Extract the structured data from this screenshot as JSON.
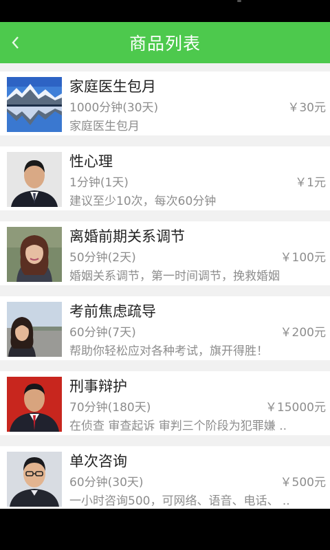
{
  "header": {
    "title": "商品列表",
    "back_icon": "chevron-left-icon"
  },
  "colors": {
    "accent": "#4dc94d",
    "title_text": "#222222",
    "secondary_text": "#8d8d8d"
  },
  "products": [
    {
      "title": "家庭医生包月",
      "duration": "1000分钟(30天)",
      "price": "￥30元",
      "desc": "家庭医生包月",
      "thumb": "mountain-lake-image"
    },
    {
      "title": "性心理",
      "duration": "1分钟(1天)",
      "price": "￥1元",
      "desc": "建议至少10次，每次60分钟",
      "thumb": "man-portrait-image"
    },
    {
      "title": "离婚前期关系调节",
      "duration": "50分钟(2天)",
      "price": "￥100元",
      "desc": "婚姻关系调节，第一时间调节，挽救婚姻",
      "thumb": "woman-portrait-image"
    },
    {
      "title": "考前焦虑疏导",
      "duration": "60分钟(7天)",
      "price": "￥200元",
      "desc": "帮助你轻松应对各种考试，旗开得胜！",
      "thumb": "woman-outdoor-image"
    },
    {
      "title": "刑事辩护",
      "duration": "70分钟(180天)",
      "price": "￥15000元",
      "desc": "在侦查 审查起诉 审判三个阶段为犯罪嫌 ..",
      "thumb": "man-red-background-image"
    },
    {
      "title": "单次咨询",
      "duration": "60分钟(30天)",
      "price": "￥500元",
      "desc": "一小时咨询500，可网络、语音、电话、 ..",
      "thumb": "man-glasses-portrait-image"
    }
  ]
}
